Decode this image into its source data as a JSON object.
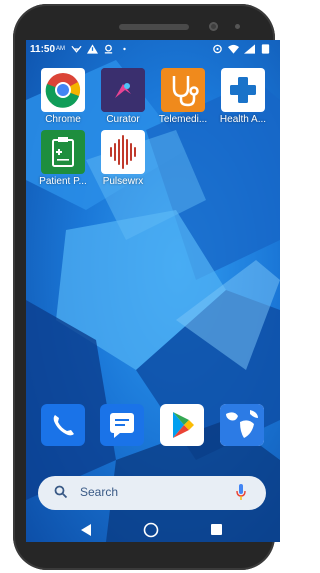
{
  "status": {
    "time": "11:50",
    "ampm": "AM"
  },
  "apps": [
    {
      "label": "Chrome",
      "icon": "chrome-icon"
    },
    {
      "label": "Curator",
      "icon": "curator-icon"
    },
    {
      "label": "Telemedi...",
      "icon": "stethoscope-icon"
    },
    {
      "label": "Health A...",
      "icon": "health-cross-icon"
    },
    {
      "label": "Patient P...",
      "icon": "clipboard-icon"
    },
    {
      "label": "Pulsewrx",
      "icon": "pulse-icon"
    }
  ],
  "dock": [
    {
      "icon": "phone-icon"
    },
    {
      "icon": "messages-icon"
    },
    {
      "icon": "play-store-icon"
    },
    {
      "icon": "maps-globe-icon"
    }
  ],
  "search": {
    "label": "Search"
  },
  "colors": {
    "accent_orange": "#f08a1c",
    "wallpaper_blue": "#1b78d8",
    "chrome_red": "#db4437",
    "pulse_red": "#c0392b",
    "clipboard_green": "#1e8e3e"
  }
}
